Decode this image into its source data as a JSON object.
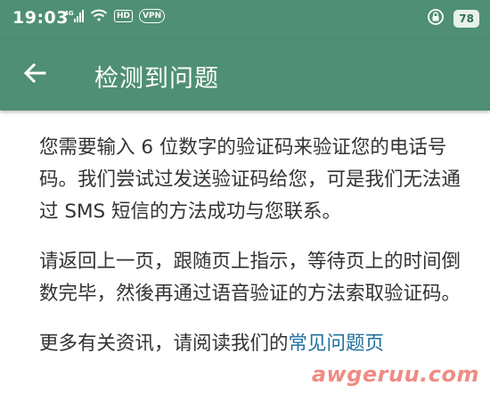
{
  "status_bar": {
    "time": "19:03",
    "network": "4G",
    "hd": "HD",
    "vpn": "VPN",
    "battery": "78"
  },
  "app_bar": {
    "title": "检测到问题",
    "background": "#4f8f75"
  },
  "content": {
    "paragraph1": "您需要输入 6 位数字的验证码来验证您的电话号码。我们尝试过发送验证码给您，可是我们无法通过 SMS 短信的方法成功与您联系。",
    "paragraph2": "请返回上一页，跟随页上指示，等待页上的时间倒数完毕，然後再通过语音验证的方法索取验证码。",
    "paragraph3_prefix": "更多有关资讯，请阅读我们的",
    "faq_link": "常见问题页"
  },
  "watermark": "awgeruu.com"
}
